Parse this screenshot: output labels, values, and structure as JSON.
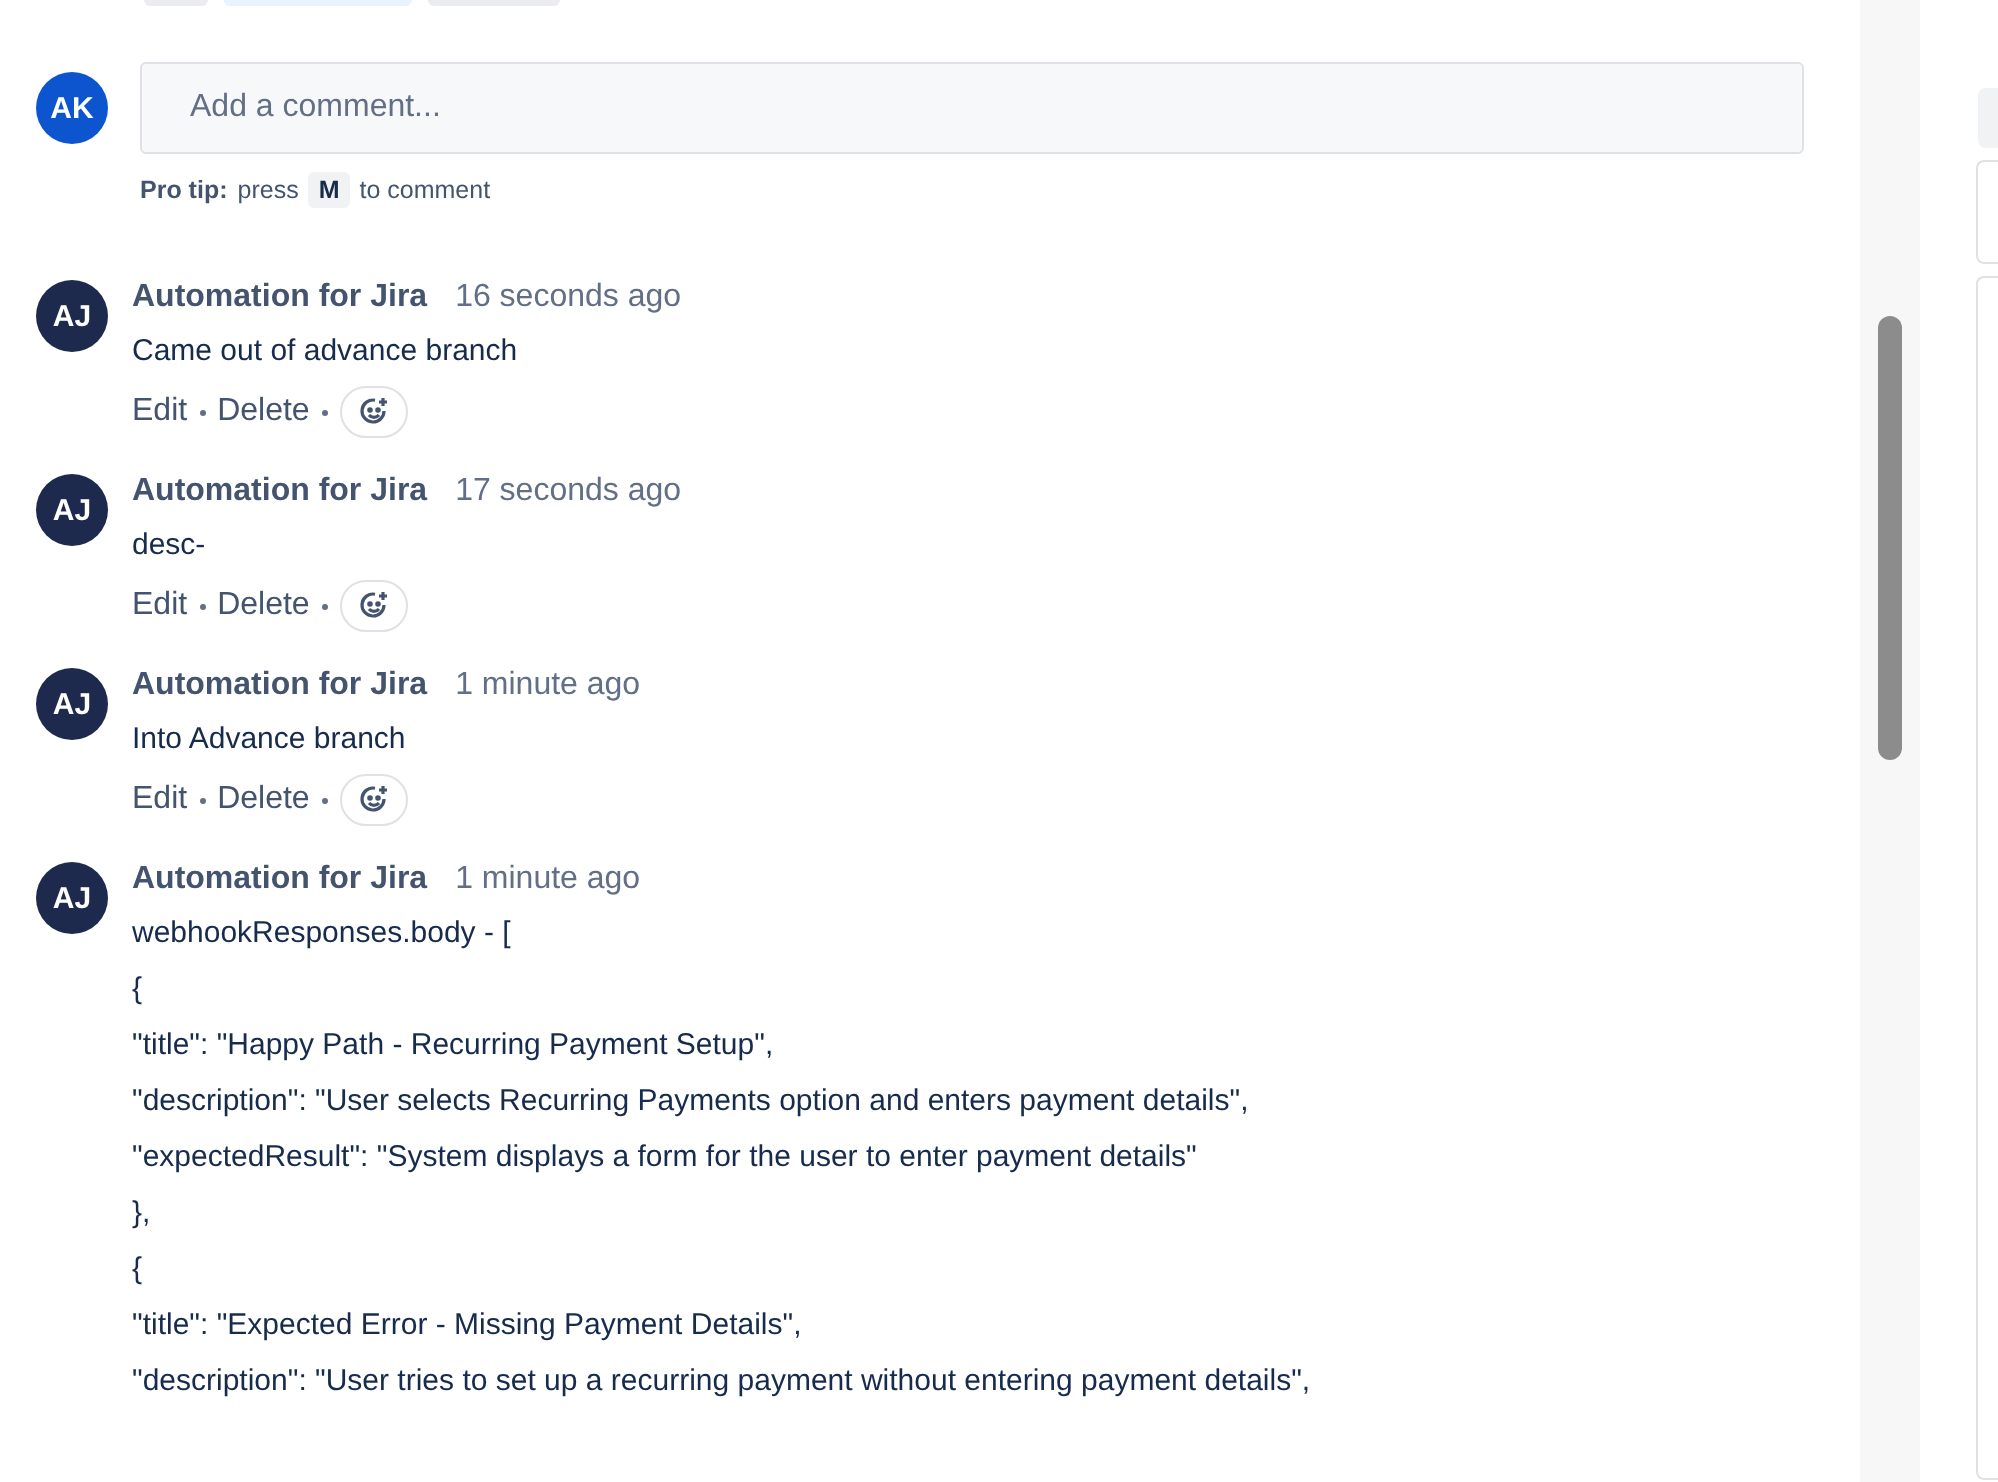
{
  "filter_tabs": [
    {
      "selected": false
    },
    {
      "selected": true
    },
    {
      "selected": false
    }
  ],
  "comment_box": {
    "avatar_initials": "AK",
    "placeholder": "Add a comment...",
    "pro_tip": {
      "label": "Pro tip:",
      "before": "press",
      "key": "M",
      "after": "to comment"
    }
  },
  "comments": [
    {
      "avatar_initials": "AJ",
      "author": "Automation for Jira",
      "time": "16 seconds ago",
      "body": [
        "Came out of advance branch"
      ],
      "actions": [
        "Edit",
        "Delete"
      ]
    },
    {
      "avatar_initials": "AJ",
      "author": "Automation for Jira",
      "time": "17 seconds ago",
      "body": [
        "desc-"
      ],
      "actions": [
        "Edit",
        "Delete"
      ]
    },
    {
      "avatar_initials": "AJ",
      "author": "Automation for Jira",
      "time": "1 minute ago",
      "body": [
        "Into Advance branch"
      ],
      "actions": [
        "Edit",
        "Delete"
      ]
    },
    {
      "avatar_initials": "AJ",
      "author": "Automation for Jira",
      "time": "1 minute ago",
      "body": [
        "webhookResponses.body - [",
        "{",
        "\"title\": \"Happy Path - Recurring Payment Setup\",",
        "\"description\": \"User selects Recurring Payments option and enters payment details\",",
        "\"expectedResult\": \"System displays a form for the user to enter payment details\"",
        "},",
        "{",
        "\"title\": \"Expected Error - Missing Payment Details\",",
        "\"description\": \"User tries to set up a recurring payment without entering payment details\","
      ]
    }
  ]
}
